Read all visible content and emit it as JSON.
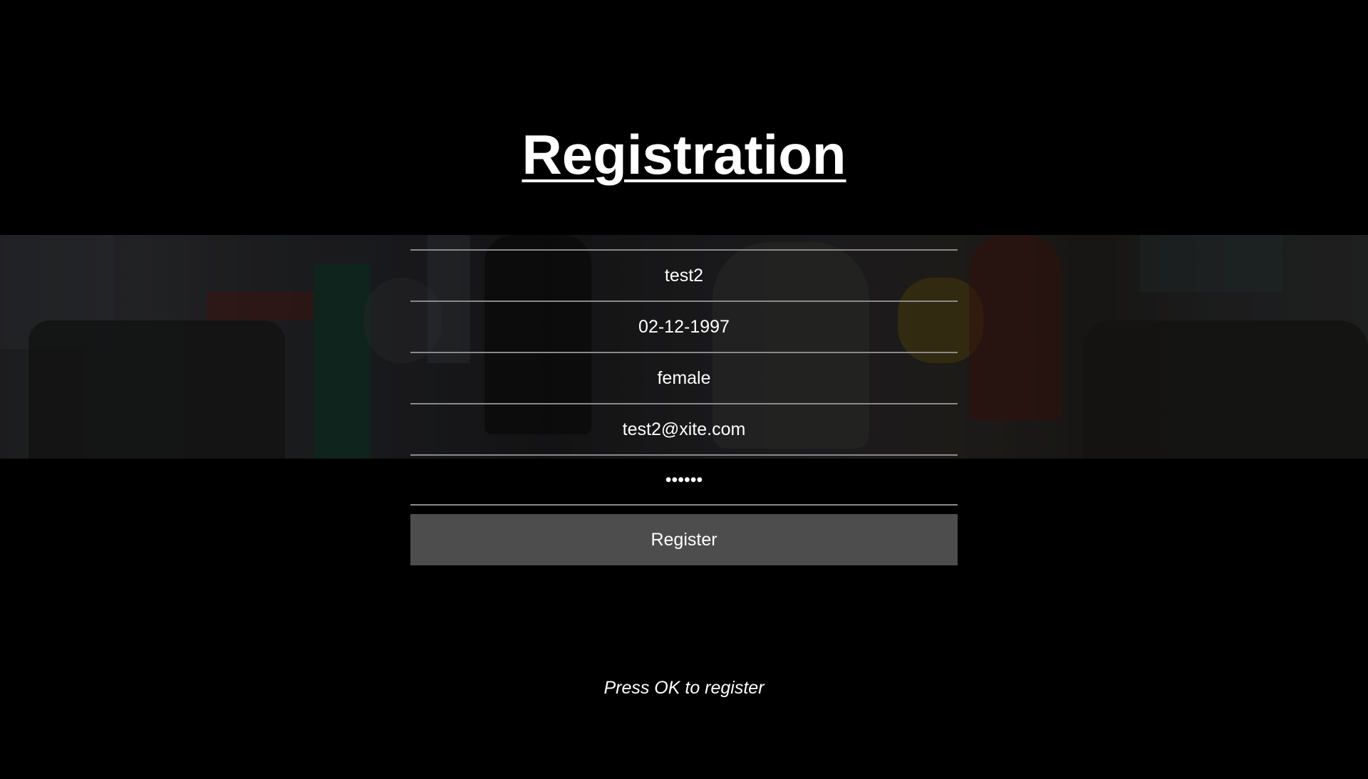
{
  "page": {
    "title": "Registration",
    "background_overlay_color": "#000000"
  },
  "form": {
    "name_value": "test2",
    "birthdate_value": "02-12-1997",
    "gender_value": "female",
    "email_value": "test2@xite.com",
    "password_value": "secret",
    "field_border_color": "#8a8a8a",
    "register_label": "Register",
    "register_button_color": "#4d4d4d"
  },
  "footer": {
    "hint": "Press OK to register"
  }
}
